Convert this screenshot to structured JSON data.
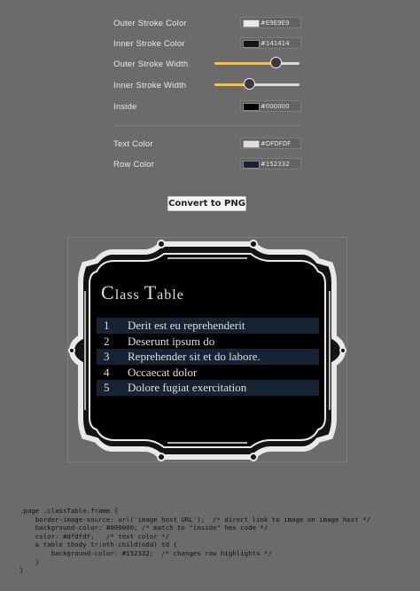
{
  "settings": {
    "outer_stroke_color": {
      "label": "Outer Stroke Color",
      "hex": "#E9E9E9",
      "swatch": "#e9e9e9"
    },
    "inner_stroke_color": {
      "label": "Inner Stroke Color",
      "hex": "#141414",
      "swatch": "#141414"
    },
    "outer_stroke_width": {
      "label": "Outer Stroke Width",
      "fraction": 0.72
    },
    "inner_stroke_width": {
      "label": "Inner Stroke Width",
      "fraction": 0.41
    },
    "inside": {
      "label": "Inside",
      "hex": "#000000",
      "swatch": "#000000"
    },
    "text_color": {
      "label": "Text Color",
      "hex": "#DFDFDF",
      "swatch": "#dfdfdf"
    },
    "row_color": {
      "label": "Row Color",
      "hex": "#152332",
      "swatch": "#152332"
    }
  },
  "convert_button": "Convert to PNG",
  "preview": {
    "title_first": "C",
    "title_rest": "lass ",
    "title_second": "T",
    "title_rest2": "able",
    "rows": [
      {
        "num": "1",
        "text": "Derit est eu reprehenderit"
      },
      {
        "num": "2",
        "text": "Deserunt ipsum do"
      },
      {
        "num": "3",
        "text": "Reprehender sit et do labore."
      },
      {
        "num": "4",
        "text": "Occaecat dolor"
      },
      {
        "num": "5",
        "text": "Dolore fugiat exercitation"
      }
    ]
  },
  "code_lines": [
    ".page .classTable.frame {",
    "    border-image-source: url('image host URL');  /* direct link to image on image host */",
    "    background-color: #000000; /* match to \"inside\" hex code */",
    "    color: #dfdfdf;   /* text color */",
    "    & table tbody tr:nth-child(odd) td {",
    "        background-color: #152332;  /* changes row highlights */",
    "    }",
    "}"
  ],
  "colors": {
    "accent": "#f4c23c",
    "frame_outer": "#e9e9e9",
    "frame_inner": "#141414",
    "inside": "#000000",
    "text": "#dfdfdf",
    "row": "#152332"
  }
}
